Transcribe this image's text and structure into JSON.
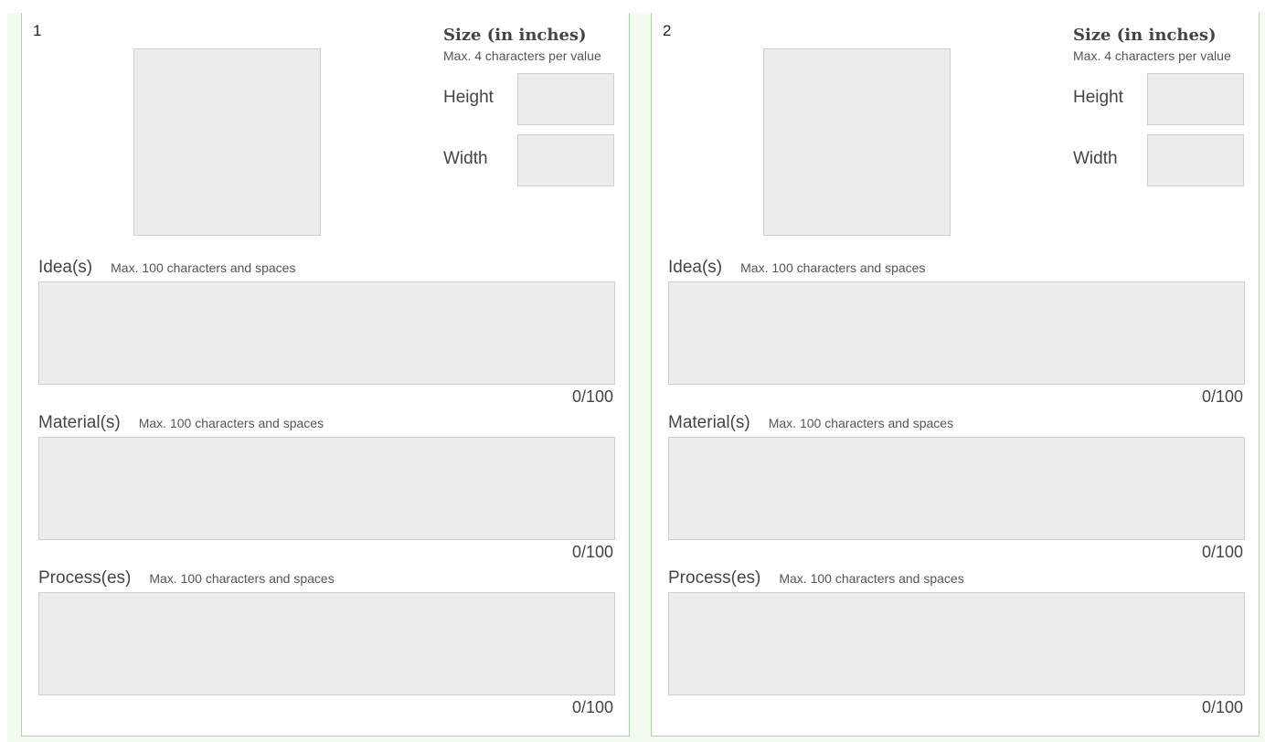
{
  "size_section": {
    "title": "Size (in inches)",
    "hint": "Max. 4 characters per value",
    "height_label": "Height",
    "width_label": "Width"
  },
  "cards": [
    {
      "number": "1",
      "height_value": "",
      "width_value": "",
      "fields": {
        "ideas": {
          "label": "Idea(s)",
          "hint": "Max. 100 characters and spaces",
          "value": "",
          "counter": "0/100"
        },
        "materials": {
          "label": "Material(s)",
          "hint": "Max. 100 characters and spaces",
          "value": "",
          "counter": "0/100"
        },
        "processes": {
          "label": "Process(es)",
          "hint": "Max. 100 characters and spaces",
          "value": "",
          "counter": "0/100"
        }
      }
    },
    {
      "number": "2",
      "height_value": "",
      "width_value": "",
      "fields": {
        "ideas": {
          "label": "Idea(s)",
          "hint": "Max. 100 characters and spaces",
          "value": "",
          "counter": "0/100"
        },
        "materials": {
          "label": "Material(s)",
          "hint": "Max. 100 characters and spaces",
          "value": "",
          "counter": "0/100"
        },
        "processes": {
          "label": "Process(es)",
          "hint": "Max. 100 characters and spaces",
          "value": "",
          "counter": "0/100"
        }
      }
    }
  ],
  "colors": {
    "page_background": "#f4fcf2",
    "card_border": "#a9d8a0",
    "input_fill": "#ededed",
    "input_border": "#cfcfcf"
  }
}
